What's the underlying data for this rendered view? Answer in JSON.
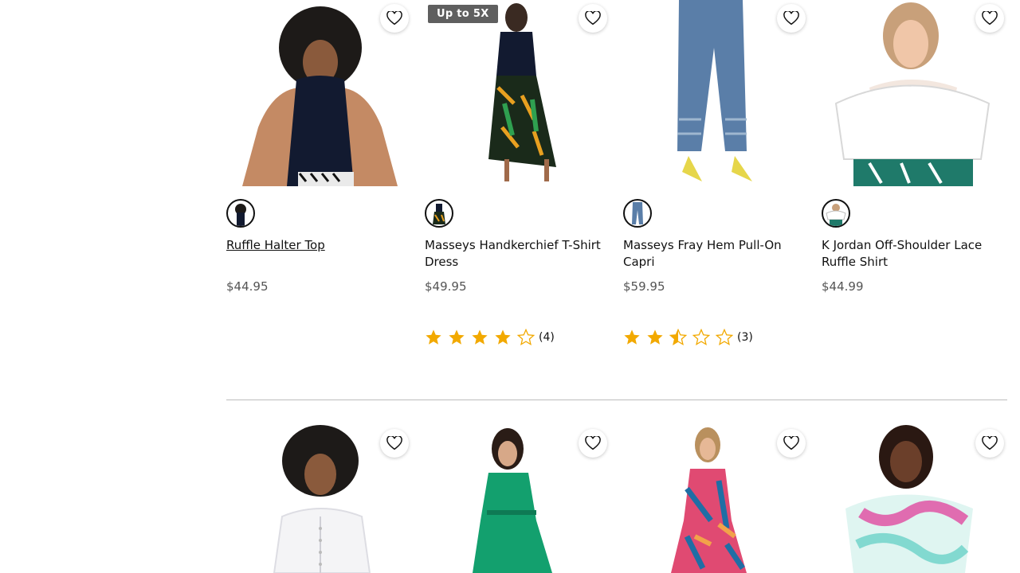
{
  "products_row1": [
    {
      "name": "Ruffle Halter Top",
      "price": "$44.95",
      "badge": "",
      "rating_count": ""
    },
    {
      "name": "Masseys Handkerchief T-Shirt Dress",
      "price": "$49.95",
      "badge": "Up to 5X",
      "rating": 4,
      "rating_count": "(4)"
    },
    {
      "name": "Masseys Fray Hem Pull-On Capri",
      "price": "$59.95",
      "badge": "",
      "rating": 2.5,
      "rating_count": "(3)"
    },
    {
      "name": "K Jordan Off-Shoulder Lace Ruffle Shirt",
      "price": "$44.99",
      "badge": "",
      "rating_count": ""
    }
  ],
  "colors": {
    "star": "#f2a900",
    "badge_bg": "#5f5f5f",
    "divider": "#bdbdbd"
  },
  "icons": {
    "favorite": "heart-outline-icon",
    "rating": "star-icon"
  }
}
